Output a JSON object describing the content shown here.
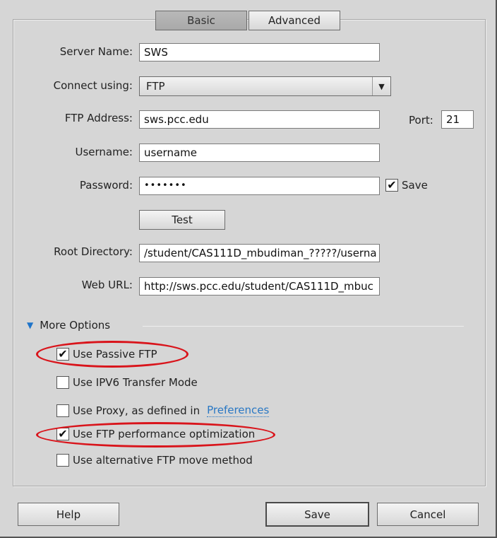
{
  "tabs": [
    {
      "label": "Basic",
      "active": true
    },
    {
      "label": "Advanced",
      "active": false
    }
  ],
  "form": {
    "server_name": {
      "label": "Server Name:",
      "value": "SWS"
    },
    "connect_using": {
      "label": "Connect using:",
      "value": "FTP"
    },
    "ftp_address": {
      "label": "FTP Address:",
      "value": "sws.pcc.edu"
    },
    "port": {
      "label": "Port:",
      "value": "21"
    },
    "username": {
      "label": "Username:",
      "value": "username"
    },
    "password": {
      "label": "Password:",
      "value": "•••••••"
    },
    "save_password": {
      "label": "Save",
      "checked": true
    },
    "test_button": "Test",
    "root_directory": {
      "label": "Root Directory:",
      "value": "/student/CAS111D_mbudiman_?????/userna"
    },
    "web_url": {
      "label": "Web URL:",
      "value": "http://sws.pcc.edu/student/CAS111D_mbuc"
    }
  },
  "more_options": {
    "label": "More Options",
    "options": [
      {
        "label": "Use Passive FTP",
        "checked": true,
        "highlighted": true
      },
      {
        "label": "Use IPV6 Transfer Mode",
        "checked": false,
        "highlighted": false
      },
      {
        "label": "Use Proxy, as defined in",
        "checked": false,
        "highlighted": false,
        "link": "Preferences"
      },
      {
        "label": "Use FTP performance optimization",
        "checked": true,
        "highlighted": true
      },
      {
        "label": "Use alternative FTP move method",
        "checked": false,
        "highlighted": false
      }
    ]
  },
  "footer": {
    "help": "Help",
    "save": "Save",
    "cancel": "Cancel"
  },
  "colors": {
    "highlight_ellipse": "#d9141b",
    "link": "#2a78c4",
    "triangle": "#1f74c9"
  },
  "icons": {
    "check": "✔",
    "dropdown": "▼",
    "expand": "▼"
  }
}
